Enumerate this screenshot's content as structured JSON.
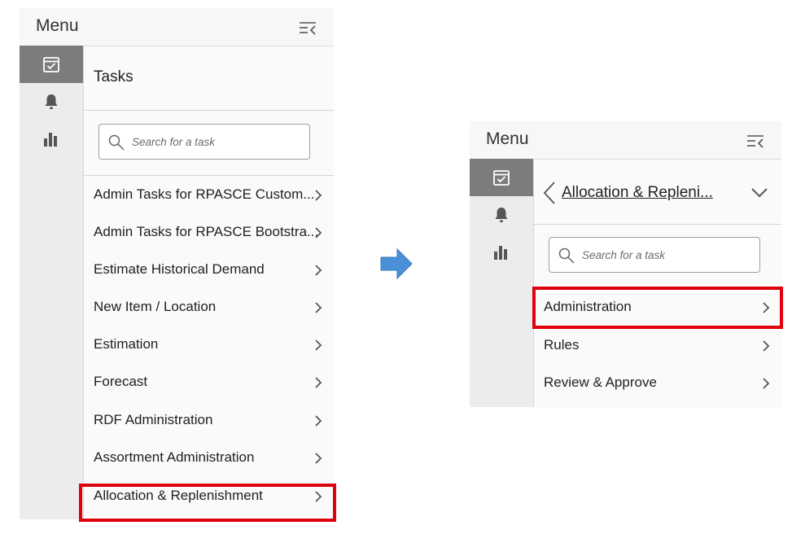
{
  "left_panel": {
    "menu_title": "Menu",
    "section_title": "Tasks",
    "search_placeholder": "Search for a task",
    "items": [
      {
        "label": "Admin Tasks for RPASCE Custom..."
      },
      {
        "label": "Admin Tasks for RPASCE Bootstra..."
      },
      {
        "label": "Estimate Historical Demand"
      },
      {
        "label": "New Item / Location"
      },
      {
        "label": "Estimation"
      },
      {
        "label": "Forecast"
      },
      {
        "label": "RDF Administration"
      },
      {
        "label": "Assortment Administration"
      },
      {
        "label": "Allocation & Replenishment"
      }
    ],
    "highlighted_item": "Allocation & Replenishment"
  },
  "right_panel": {
    "menu_title": "Menu",
    "breadcrumb": "Allocation & Repleni...",
    "search_placeholder": "Search for a task",
    "items": [
      {
        "label": "Administration"
      },
      {
        "label": "Rules"
      },
      {
        "label": "Review & Approve"
      }
    ],
    "highlighted_item": "Administration"
  },
  "icons": {
    "rail": [
      "calendar-check-icon",
      "bell-icon",
      "bar-chart-icon"
    ],
    "header": "collapse-menu-icon",
    "search": "search-icon",
    "item": "chevron-right-icon",
    "flow": "arrow-right-icon"
  },
  "colors": {
    "highlight": "#e0000b",
    "arrow": "#4a90d9",
    "rail_active": "#7c7c7c",
    "rail": "#ececec"
  }
}
